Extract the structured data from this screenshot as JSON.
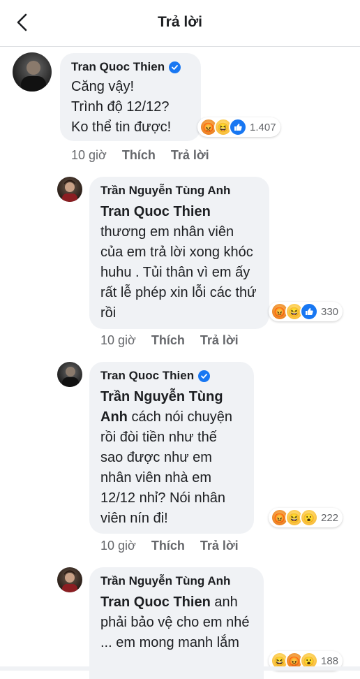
{
  "header": {
    "title": "Trả lời"
  },
  "comments": [
    {
      "author": "Tran Quoc Thien",
      "verified": true,
      "text": "Căng vậy!\nTrình độ 12/12?\nKo thể tin được!",
      "reactions": [
        "angry",
        "haha",
        "like"
      ],
      "reaction_count": "1.407",
      "time": "10 giờ",
      "like_label": "Thích",
      "reply_label": "Trả lời"
    },
    {
      "author": "Trần Nguyễn Tùng Anh",
      "mention": "Tran Quoc Thien",
      "text": "thương em nhân viên của em trả lời xong khóc huhu . Tủi thân vì em ấy rất lễ phép xin lỗi các thứ rồi",
      "reactions": [
        "angry",
        "haha",
        "like"
      ],
      "reaction_count": "330",
      "time": "10 giờ",
      "like_label": "Thích",
      "reply_label": "Trả lời"
    },
    {
      "author": "Tran Quoc Thien",
      "verified": true,
      "mention": "Trần Nguyễn Tùng Anh",
      "text": "cách nói chuyện rồi đòi tiền như thế sao được như em nhân viên nhà em 12/12 nhỉ? Nói nhân viên nín đi!",
      "reactions": [
        "angry",
        "haha",
        "wow"
      ],
      "reaction_count": "222",
      "time": "10 giờ",
      "like_label": "Thích",
      "reply_label": "Trả lời"
    },
    {
      "author": "Trần Nguyễn Tùng Anh",
      "mention": "Tran Quoc Thien",
      "text": "anh phải bảo vệ cho em nhé ... em mong manh lắm",
      "reactions": [
        "haha",
        "angry",
        "wow"
      ],
      "reaction_count": "188"
    }
  ],
  "icons": {
    "back": "chevron-left-icon",
    "verified": "verified-badge-icon",
    "reaction_angry": "angry-reaction-icon",
    "reaction_haha": "haha-reaction-icon",
    "reaction_like": "like-reaction-icon",
    "reaction_wow": "wow-reaction-icon"
  },
  "colors": {
    "bubble": "#f0f2f5",
    "verified": "#1877f2",
    "secondary_text": "#65676b"
  }
}
